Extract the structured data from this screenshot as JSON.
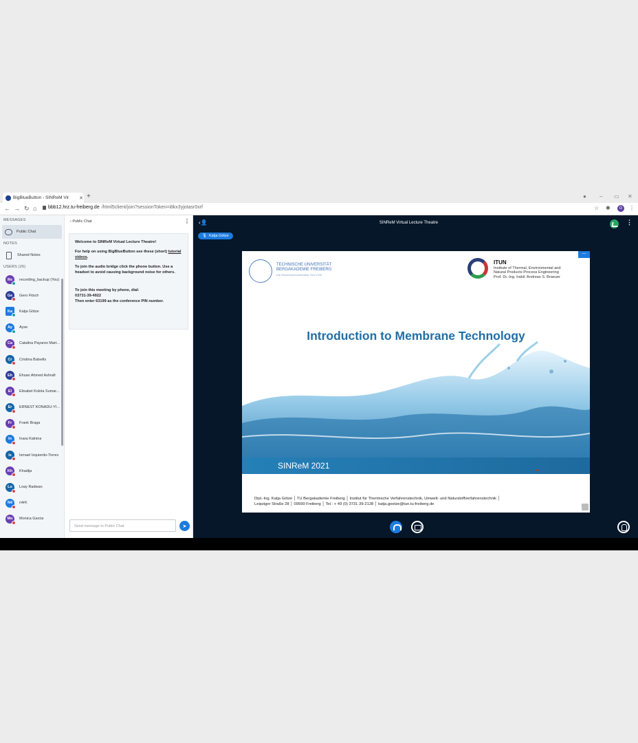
{
  "browser": {
    "tab_title": "BigBlueButton - SINReM Vir",
    "url_host": "bbb12.hrz.tu-freiberg.de",
    "url_path": "/html5client/join?sessionToken=i8kx3yjotasr0xrf",
    "profile_initial": "G"
  },
  "sidebar": {
    "messages_header": "MESSAGES",
    "public_chat_label": "Public Chat",
    "notes_header": "NOTES",
    "shared_notes_label": "Shared Notes",
    "users_header": "USERS (26)",
    "users": [
      {
        "initials": "Re",
        "name": "recording_backup (You)",
        "color": "#6a3fb3",
        "status": "teal"
      },
      {
        "initials": "Ge",
        "name": "Gero Fitsch",
        "color": "#2c3e9a",
        "status": "red"
      },
      {
        "initials": "Ka",
        "name": "Katja Götze",
        "color": "#1d7be0",
        "status": "teal"
      },
      {
        "initials": "Ay",
        "name": "Ayse",
        "color": "#1d7be0",
        "status": "teal"
      },
      {
        "initials": "Ca",
        "name": "Catalina Payares Mart...",
        "color": "#6a3fb3",
        "status": "red"
      },
      {
        "initials": "Cr",
        "name": "Cristina Balsells",
        "color": "#1565a8",
        "status": "red"
      },
      {
        "initials": "Eh",
        "name": "Ehsan Ahmed Ashrafi",
        "color": "#2c3e9a",
        "status": "red"
      },
      {
        "initials": "El",
        "name": "Elisabet Kolola Sumar...",
        "color": "#6a3fb3",
        "status": "red"
      },
      {
        "initials": "Er",
        "name": "ERNEST KONADU-YIA...",
        "color": "#1565a8",
        "status": "red"
      },
      {
        "initials": "Fr",
        "name": "Frank Braga",
        "color": "#6a3fb3",
        "status": "red"
      },
      {
        "initials": "In",
        "name": "Inara Kalnina",
        "color": "#1d7be0",
        "status": "red"
      },
      {
        "initials": "Is",
        "name": "Ismael Izquierdo-Torres",
        "color": "#1565a8",
        "status": "red"
      },
      {
        "initials": "Kh",
        "name": "Khadija",
        "color": "#6a3fb3",
        "status": "red"
      },
      {
        "initials": "Lo",
        "name": "Loay Radwan",
        "color": "#1565a8",
        "status": "red"
      },
      {
        "initials": "N4",
        "name": "n4rK",
        "color": "#1d7be0",
        "status": "red"
      },
      {
        "initials": "Mo",
        "name": "Monica Garcia",
        "color": "#6a3fb3",
        "status": "red"
      }
    ]
  },
  "chat": {
    "header": "Public Chat",
    "welcome_title": "Welcome to SINReM Virtual Lecture Theatre!",
    "help_text": "For help on using BigBlueButton see these (short)",
    "help_link": "tutorial videos",
    "audio_text": "To join the audio bridge click the phone button. Use a headset to avoid causing background noise for others.",
    "phone_text": "To join this meeting by phone, dial:",
    "phone_number": "03731-39-4922",
    "pin_text": "Then enter 63199 as the conference PIN number.",
    "input_placeholder": "Send message to Public Chat"
  },
  "main": {
    "title": "SINReM Virtual Lecture Theatre",
    "presenter": "Katja Götze"
  },
  "slide": {
    "tu_name_1": "TECHNISCHE UNIVERSITÄT",
    "tu_name_2": "BERGAKADEMIE FREIBERG",
    "tu_tagline": "Die Ressourcenuniversität. Seit 1765.",
    "itun_title": "ITUN",
    "itun_line1": "Institute of Thermal, Environmental and",
    "itun_line2": "Natural Products Process Engineering",
    "itun_line3": "Prof. Dr.-Ing. habil. Andreas S. Braeuer",
    "title": "Introduction to Membrane Technology",
    "band_text": "SINReM 2021",
    "footer_line1": "Dipl.-Ing. Katja Götze │ TU Bergakademie Freiberg │ Institut für Thermische Verfahrenstechnik, Umwelt- und Naturstoffverfahrenstechnik │",
    "footer_line2": "Leipziger Straße 28 │ 09599 Freiberg │ Tel.: + 49 (0) 3731 39-2128 │ katja.goetze@tun.tu-freiberg.de"
  }
}
